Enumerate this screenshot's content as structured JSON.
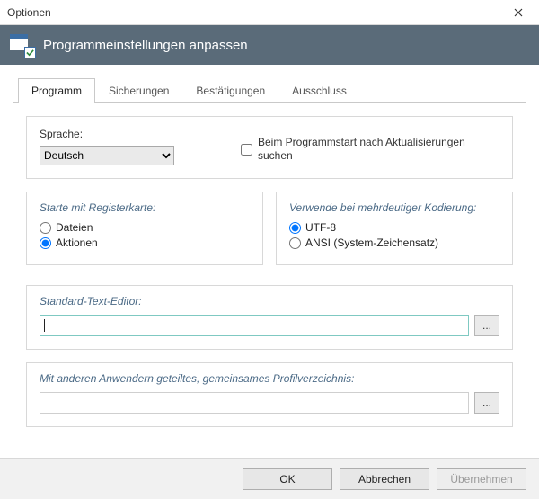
{
  "window": {
    "title": "Optionen"
  },
  "header": {
    "title": "Programmeinstellungen anpassen"
  },
  "tabs": [
    {
      "label": "Programm",
      "active": true
    },
    {
      "label": "Sicherungen",
      "active": false
    },
    {
      "label": "Bestätigungen",
      "active": false
    },
    {
      "label": "Ausschluss",
      "active": false
    }
  ],
  "language": {
    "label": "Sprache:",
    "selected": "Deutsch",
    "options": [
      "Deutsch"
    ]
  },
  "updates": {
    "checked": false,
    "label": "Beim Programmstart nach Aktualisierungen suchen"
  },
  "start_tab_group": {
    "title": "Starte mit Registerkarte:",
    "options": [
      {
        "label": "Dateien",
        "checked": false
      },
      {
        "label": "Aktionen",
        "checked": true
      }
    ]
  },
  "encoding_group": {
    "title": "Verwende bei mehrdeutiger Kodierung:",
    "options": [
      {
        "label": "UTF-8",
        "checked": true
      },
      {
        "label": "ANSI (System-Zeichensatz)",
        "checked": false
      }
    ]
  },
  "editor_group": {
    "title": "Standard-Text-Editor:",
    "value": "",
    "browse": "..."
  },
  "profile_group": {
    "title": "Mit anderen Anwendern geteiltes, gemeinsames Profilverzeichnis:",
    "value": "",
    "browse": "..."
  },
  "buttons": {
    "ok": "OK",
    "cancel": "Abbrechen",
    "apply": "Übernehmen"
  }
}
